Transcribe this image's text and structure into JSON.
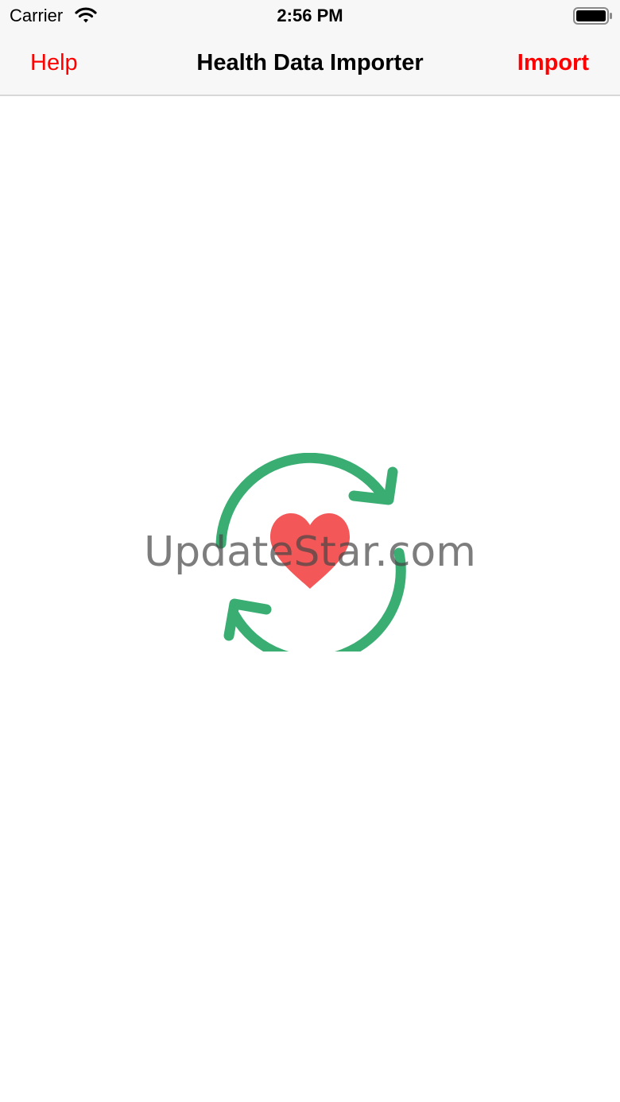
{
  "status_bar": {
    "carrier": "Carrier",
    "time": "2:56 PM",
    "wifi_icon": "wifi-icon",
    "battery_icon": "battery-icon"
  },
  "nav": {
    "left_label": "Help",
    "title": "Health Data Importer",
    "right_label": "Import"
  },
  "main": {
    "logo_icon": "sync-heart-icon",
    "watermark": "UpdateStar.com"
  },
  "colors": {
    "accent": "#ff0000",
    "sync_green": "#3aae72",
    "heart_red": "#f35757",
    "bar_bg": "#f7f7f7"
  }
}
